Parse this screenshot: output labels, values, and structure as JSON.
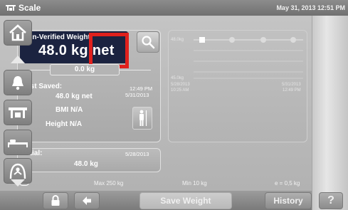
{
  "title_bar": {
    "title": "Scale",
    "datetime": "May 31, 2013 12:51 PM"
  },
  "weight_panel": {
    "label": "Non-Verified Weight:",
    "value": "48.0 kg net",
    "tare": "0.0 kg",
    "last_saved_label": "Last Saved:",
    "last_saved_time": "12:49 PM",
    "last_saved_value": "48.0 kg net",
    "last_saved_date": "5/31/2013",
    "bmi": "BMI N/A",
    "height": "Height N/A"
  },
  "initial_panel": {
    "label": "Initial:",
    "date": "5/28/2013",
    "value": "48.0 kg"
  },
  "trend_chart": {
    "y_top_label": "48.0kg",
    "y_bottom_label": "45.0kg",
    "start_date": "5/28/2013",
    "start_time": "10:25 AM",
    "end_date": "5/31/2013",
    "end_time": "12:49 PM"
  },
  "footer": {
    "max": "Max 250 kg",
    "min": "Min 10 kg",
    "resolution": "e = 0,5 kg"
  },
  "bottom_bar": {
    "save_label": "Save Weight",
    "history_label": "History",
    "help_label": "?"
  },
  "icons": [
    "scale-icon",
    "search-icon",
    "person-height-icon",
    "home-icon",
    "up-arrow-icon",
    "bell-icon",
    "scale-nav-icon",
    "bed-icon",
    "patient-lift-icon",
    "down-arrow-icon",
    "lock-icon",
    "back-arrow-icon",
    "battery-icon"
  ]
}
